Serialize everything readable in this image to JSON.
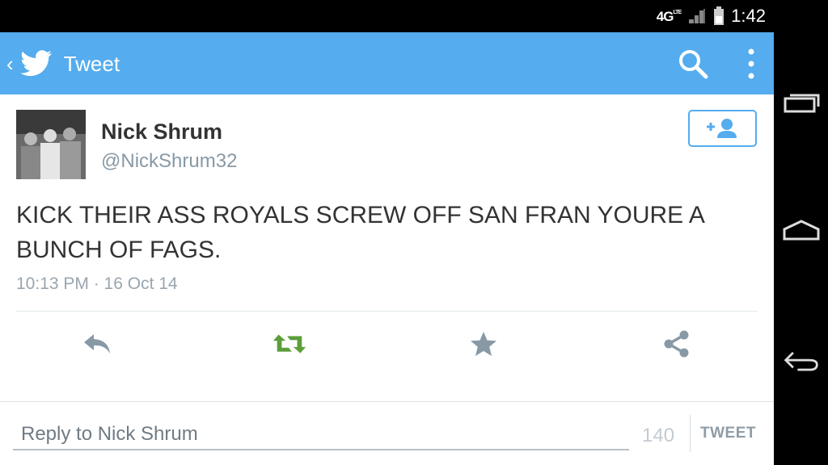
{
  "status_bar": {
    "network": "4G",
    "network_sub": "LTE",
    "time": "1:42"
  },
  "app_bar": {
    "back": "‹",
    "title": "Tweet"
  },
  "tweet": {
    "name": "Nick Shrum",
    "handle": "@NickShrum32",
    "text": "KICK THEIR ASS ROYALS SCREW OFF SAN FRAN YOURE A BUNCH OF FAGS.",
    "timestamp": "10:13 PM · 16 Oct 14"
  },
  "reply": {
    "placeholder": "Reply to Nick Shrum",
    "char_count": "140",
    "tweet_label": "TWEET"
  },
  "colors": {
    "accent": "#55acee",
    "retweet_green": "#5c9e3a",
    "icon_gray": "#8899a6"
  }
}
